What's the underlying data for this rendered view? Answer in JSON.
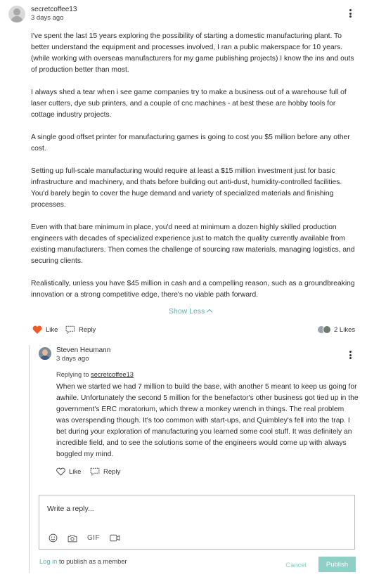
{
  "post": {
    "author": "secretcoffee13",
    "timestamp": "3 days ago",
    "paragraphs": [
      "I've spent the last 15 years exploring the possibility of starting a domestic manufacturing plant. To better understand the equipment and processes involved, I ran a public makerspace for 10 years. (while working with overseas manufacturers for my game publishing projects) I know the ins and outs of production better than most.",
      "I always shed a tear when i see game companies try to make a business out of a warehouse full of laser cutters, dye sub printers, and a couple of cnc machines - at best these are hobby tools for cottage industry projects.",
      "A single good offset printer for manufacturing games is going to cost you $5 million before any other cost.",
      "Setting up full-scale manufacturing would require at least a $15 million investment just for basic infrastructure and machinery, and thats before building out anti-dust, humidity-controlled facilities. You'd barely begin to cover the huge demand and variety of specialized materials and finishing processes.",
      "Even with that bare minimum in place, you'd need at minimum a dozen highly skilled production engineers with decades of specialized experience just to match the quality currently available from existing manufacturers. Then comes the challenge of sourcing raw materials, managing logistics, and securing clients.",
      "Realistically, unless you have $45 million in cash and a compelling reason, such as a groundbreaking innovation or a strong competitive edge, there's no viable path forward."
    ],
    "show_less_label": "Show Less",
    "like_label": "Like",
    "reply_label": "Reply",
    "reply_count_label": "2 Likes"
  },
  "reply": {
    "author": "Steven Heumann",
    "timestamp": "3 days ago",
    "replying_to_prefix": "Replying to",
    "replying_to_user": "secretcoffee13",
    "body": "When we started we had 7 million to build the base, with another 5 meant to keep us going for awhile. Unfortunately the second 5 million for the benefactor's other business got tied up in the government's ERC moratorium, which threw a monkey wrench in things. The real problem was overspending though. It's too common with start-ups, and Quimbley's fell into the trap. I bet during your exploration of manufacturing you learned some cool stuff. It was definitely an incredible field, and to see the solutions some of the engineers would come up with always boggled my mind.",
    "like_label": "Like",
    "reply_label": "Reply"
  },
  "composer": {
    "placeholder": "Write a reply...",
    "icons": [
      "emoji-icon",
      "camera-icon",
      "gif-icon",
      "video-icon"
    ],
    "gif_label": "GIF",
    "login_link": "Log in",
    "login_suffix": "to publish as a member",
    "cancel_label": "Cancel",
    "publish_label": "Publish"
  },
  "colors": {
    "accent": "#59b5a9",
    "like_heart": "#f05a28",
    "publish_bg": "#8ecfc6"
  }
}
